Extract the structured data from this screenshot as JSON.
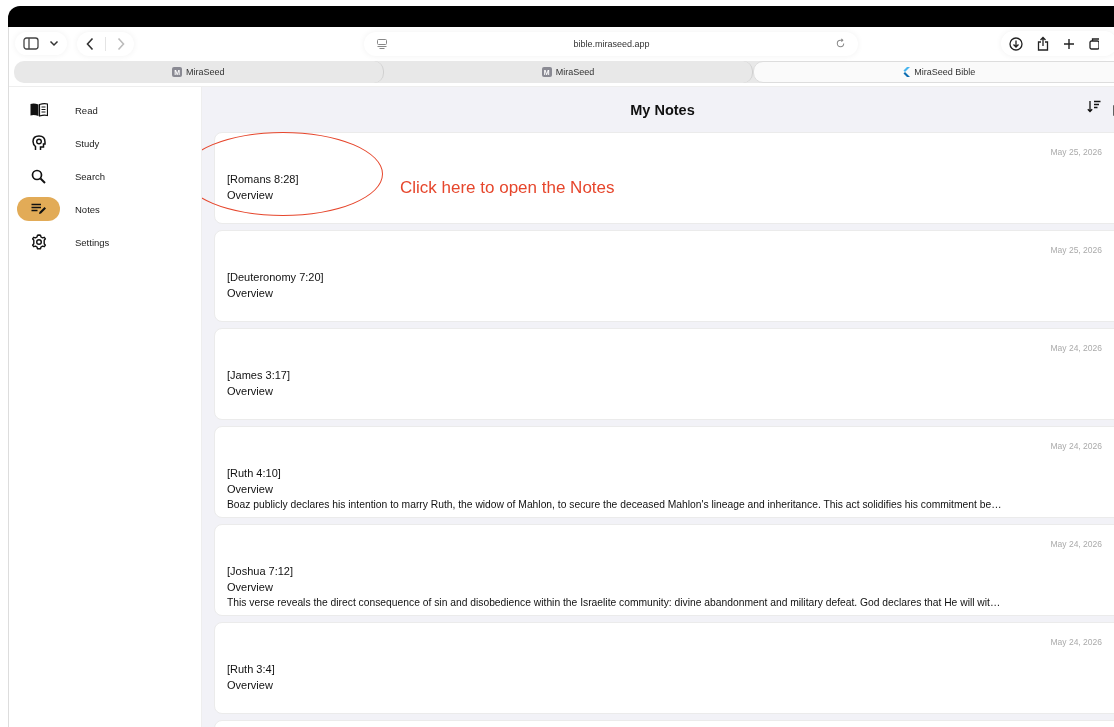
{
  "browser": {
    "url": "bible.miraseed.app",
    "back_disabled": false,
    "forward_disabled": true
  },
  "tabs": [
    {
      "label": "MiraSeed",
      "favicon_letter": "M",
      "kind": "letter",
      "selected": false
    },
    {
      "label": "MiraSeed",
      "favicon_letter": "M",
      "kind": "letter",
      "selected": false
    },
    {
      "label": "MiraSeed Bible",
      "kind": "app",
      "selected": true
    }
  ],
  "sidebar": {
    "items": [
      {
        "label": "Read",
        "selected": false
      },
      {
        "label": "Study",
        "selected": false
      },
      {
        "label": "Search",
        "selected": false
      },
      {
        "label": "Notes",
        "selected": true
      },
      {
        "label": "Settings",
        "selected": false
      }
    ]
  },
  "page": {
    "title": "My Notes"
  },
  "notes": [
    {
      "date": "May 25, 2026",
      "reference": "[Romans 8:28]",
      "heading": "Overview"
    },
    {
      "date": "May 25, 2026",
      "reference": "[Deuteronomy 7:20]",
      "heading": "Overview"
    },
    {
      "date": "May 24, 2026",
      "reference": "[James 3:17]",
      "heading": "Overview"
    },
    {
      "date": "May 24, 2026",
      "reference": "[Ruth 4:10]",
      "heading": "Overview",
      "excerpt": "Boaz publicly declares his intention to marry Ruth, the widow of Mahlon, to secure the deceased Mahlon's lineage and inheritance. This act solidifies his commitment be…"
    },
    {
      "date": "May 24, 2026",
      "reference": "[Joshua 7:12]",
      "heading": "Overview",
      "excerpt": "This verse reveals the direct consequence of sin and disobedience within the Israelite community: divine abandonment and military defeat. God declares that He will wit…"
    },
    {
      "date": "May 24, 2026",
      "reference": "[Ruth 3:4]",
      "heading": "Overview"
    }
  ],
  "annotation": {
    "text": "Click here to open the Notes"
  }
}
